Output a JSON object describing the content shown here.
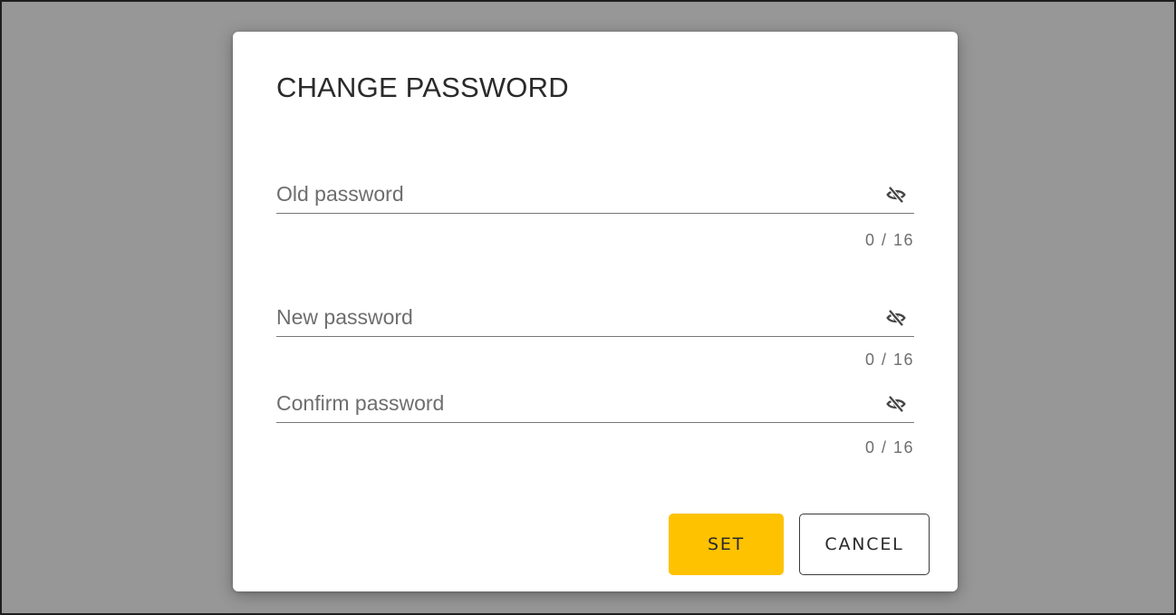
{
  "dialog": {
    "title": "CHANGE PASSWORD",
    "fields": [
      {
        "name": "old",
        "placeholder": "Old password",
        "value": "",
        "counter": "0 / 16"
      },
      {
        "name": "new",
        "placeholder": "New password",
        "value": "",
        "counter": "0 / 16"
      },
      {
        "name": "confirm",
        "placeholder": "Confirm password",
        "value": "",
        "counter": "0 / 16"
      }
    ],
    "icons": {
      "visibility_toggle": "eye-off-icon"
    },
    "buttons": {
      "set_label": "SET",
      "cancel_label": "CANCEL"
    }
  },
  "colors": {
    "backdrop": "#979797",
    "accent": "#fec200",
    "text": "#2a2a2a",
    "muted": "#6e6e6e"
  }
}
